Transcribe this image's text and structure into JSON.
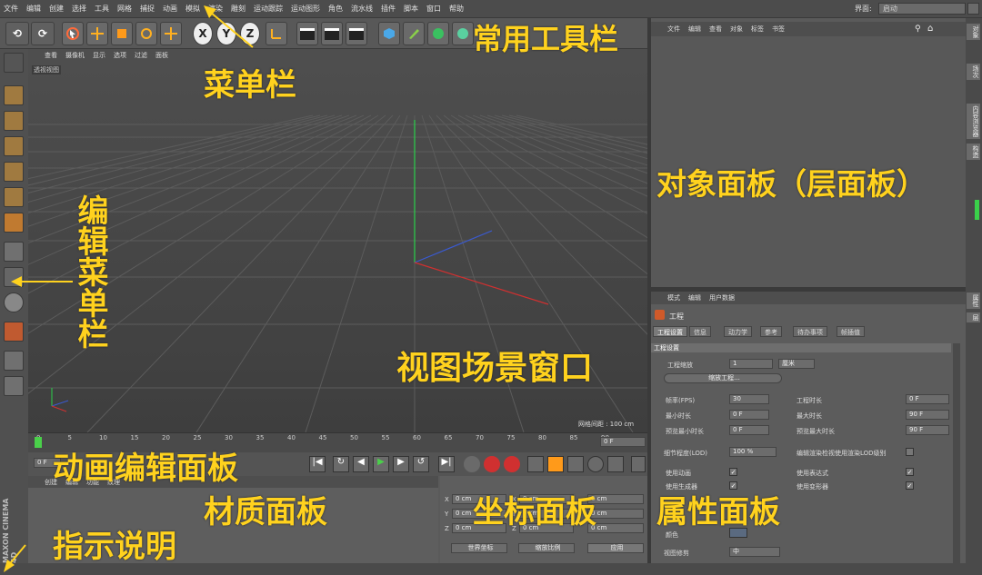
{
  "menu": [
    "文件",
    "编辑",
    "创建",
    "选择",
    "工具",
    "网格",
    "捕捉",
    "动画",
    "模拟",
    "渲染",
    "雕刻",
    "运动跟踪",
    "运动图形",
    "角色",
    "流水线",
    "插件",
    "脚本",
    "窗口",
    "帮助"
  ],
  "layout": {
    "label": "界面:",
    "value": "启动"
  },
  "toolbar": {
    "x": "X",
    "y": "Y",
    "z": "Z"
  },
  "viewport": {
    "menu": [
      "查看",
      "摄像机",
      "显示",
      "选项",
      "过滤",
      "面板"
    ],
    "label": "透视视图",
    "grid_info": "网格间距 : 100 cm"
  },
  "timeline": {
    "ticks": [
      "0",
      "5",
      "10",
      "15",
      "20",
      "25",
      "30",
      "35",
      "40",
      "45",
      "50",
      "55",
      "60",
      "65",
      "70",
      "75",
      "80",
      "85",
      "90"
    ],
    "end_frame": "0 F",
    "start_frame": "0 F"
  },
  "material": {
    "menu": [
      "创建",
      "编辑",
      "功能",
      "纹理"
    ]
  },
  "coords": {
    "axes": [
      "X",
      "Y",
      "Z"
    ],
    "value": "0 cm",
    "world": "世界坐标",
    "scale": "缩放比例",
    "apply": "应用"
  },
  "objects": {
    "menu": [
      "文件",
      "编辑",
      "查看",
      "对象",
      "标签",
      "书签"
    ]
  },
  "attributes": {
    "menu": [
      "模式",
      "编辑",
      "用户数据"
    ],
    "title": "工程",
    "tabs": [
      "工程设置",
      "信息",
      "动力学",
      "参考",
      "待办事项",
      "帧插值"
    ],
    "section": "工程设置",
    "scale_label": "工程缩放",
    "scale_value": "1",
    "scale_unit": "厘米",
    "scale_btn": "缩放工程...",
    "fps_label": "帧率(FPS)",
    "fps": "30",
    "proj_len_label": "工程时长",
    "proj_len": "0 F",
    "min_label": "最小时长",
    "min": "0 F",
    "max_label": "最大时长",
    "max": "90 F",
    "pmin_label": "预览最小时长",
    "pmin": "0 F",
    "pmax_label": "预览最大时长",
    "pmax": "90 F",
    "lod_label": "细节程度(LOD)",
    "lod": "100 %",
    "lod_edit": "编辑渲染检视使用渲染LOD级别",
    "anim": "使用动画",
    "expr": "使用表达式",
    "gen": "使用生成器",
    "deform": "使用变形器",
    "color": "颜色",
    "clip": "视图修剪",
    "clip_val": "中"
  },
  "side_tabs": [
    "对象",
    "场次",
    "内容浏览器",
    "构造"
  ],
  "attr_side_tabs": [
    "属性",
    "层"
  ],
  "annotations": {
    "menubar": "菜单栏",
    "toolbar": "常用工具栏",
    "objects": "对象面板（层面板）",
    "edit": "编辑菜单栏",
    "viewport": "视图场景窗口",
    "anim": "动画编辑面板",
    "material": "材质面板",
    "coords": "坐标面板",
    "attrs": "属性面板",
    "hint": "指示说明"
  },
  "brand": "MAXON CINEMA 4D"
}
